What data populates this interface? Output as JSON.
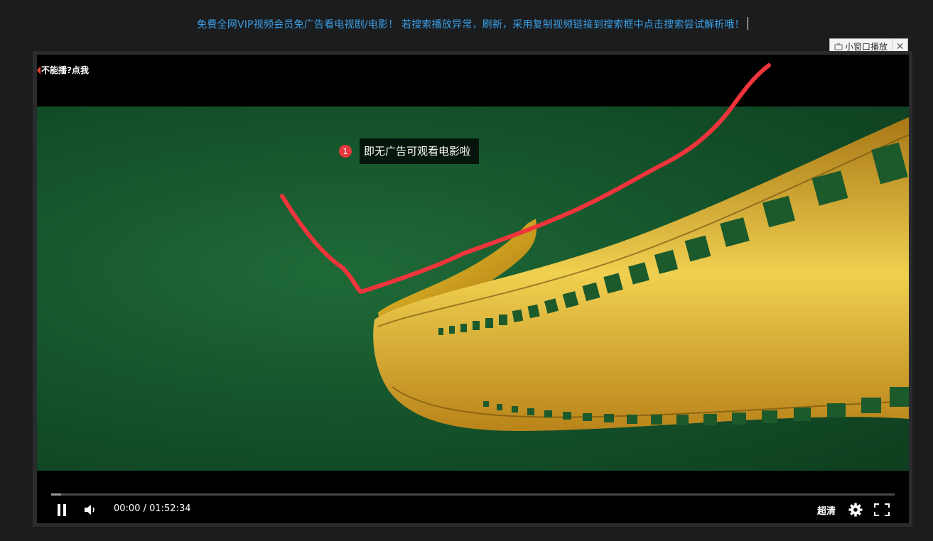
{
  "notice": {
    "text": "免费全网VIP视频会员免广告看电视剧/电影！ 若搜索播放异常，刷新，采用复制视频链接到搜索框中点击搜索尝试解析哦！"
  },
  "mini_window": {
    "label": "小窗口播放",
    "close": "✕",
    "icon": "tv-icon"
  },
  "player": {
    "help_link": "不能播?点我",
    "tip_number": "1",
    "tip_text": "即无广告可观看电影啦",
    "progress": 0.012,
    "current_time": "00:00",
    "duration": "01:52:34",
    "time_display": "00:00 / 01:52:34",
    "quality": "超清",
    "icons": {
      "pause": "pause-icon",
      "volume": "volume-icon",
      "settings": "gear-icon",
      "fullscreen": "fullscreen-icon"
    }
  },
  "colors": {
    "notice_text": "#3a9fe6",
    "annotation_stroke": "#f0343c",
    "video_green": "#1f6a37",
    "film_gold": "#e3b927"
  }
}
